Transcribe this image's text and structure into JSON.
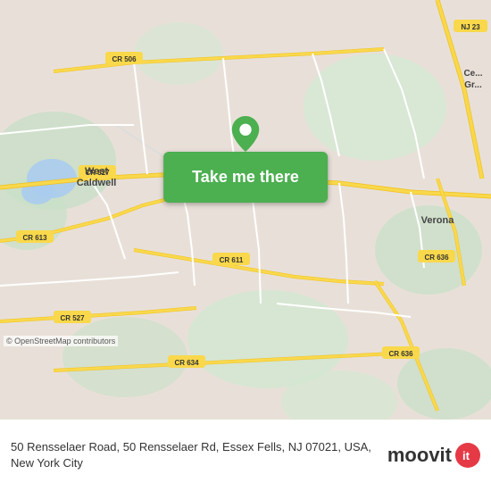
{
  "map": {
    "attribution": "© OpenStreetMap contributors",
    "center_lat": 40.838,
    "center_lon": -74.278
  },
  "button": {
    "label": "Take me there"
  },
  "address": {
    "full": "50 Rensselaer Road, 50 Rensselaer Rd, Essex Fells, NJ 07021, USA, New York City"
  },
  "branding": {
    "name": "moovit",
    "logo_symbol": "m"
  },
  "road_labels": [
    "CR 527",
    "CR 506",
    "CR 611",
    "CR 613",
    "CR 634",
    "CR 636",
    "NJ 23"
  ],
  "place_labels": [
    "West Caldwell",
    "Verona",
    "Ce... Gr..."
  ],
  "colors": {
    "map_bg": "#e8e0d8",
    "road": "#ffffff",
    "road_stroke": "#ccc",
    "highway": "#f9d84b",
    "green_area": "#c8dfc8",
    "water": "#aaccee",
    "button_bg": "#4CAF50",
    "button_text": "#ffffff",
    "pin_fill": "#4CAF50",
    "pin_hole": "#ffffff",
    "moovit_red": "#e63946",
    "info_bar_bg": "#ffffff"
  }
}
